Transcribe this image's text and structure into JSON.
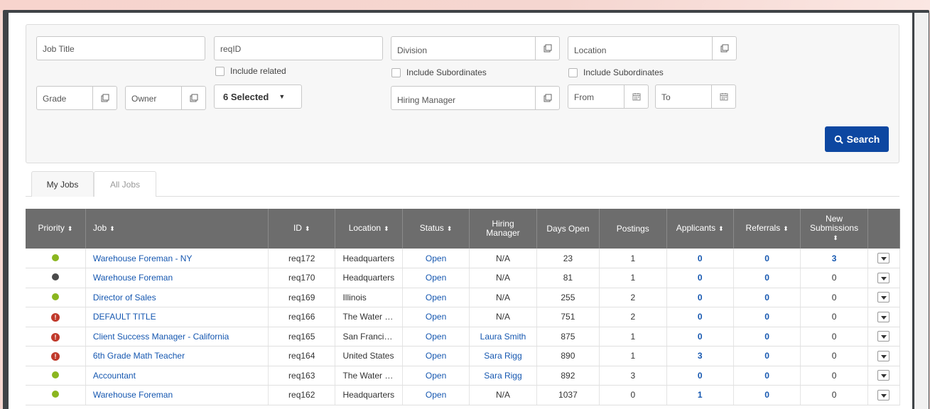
{
  "filters": {
    "job_title": "Job Title",
    "req_id": "reqID",
    "division": "Division",
    "location": "Location",
    "include_related": "Include related",
    "include_subordinates_division": "Include Subordinates",
    "include_subordinates_location": "Include Subordinates",
    "grade": "Grade",
    "owner": "Owner",
    "status_select": "6 Selected",
    "hiring_manager": "Hiring Manager",
    "from": "From",
    "to": "To",
    "search_label": "Search"
  },
  "tabs": [
    {
      "label": "My Jobs",
      "active": true
    },
    {
      "label": "All Jobs",
      "active": false
    }
  ],
  "table": {
    "headers": {
      "priority": "Priority",
      "job": "Job",
      "id": "ID",
      "location": "Location",
      "status": "Status",
      "hiring_manager": "Hiring Manager",
      "days_open": "Days Open",
      "postings": "Postings",
      "applicants": "Applicants",
      "referrals": "Referrals",
      "new_submissions": "New Submissions"
    },
    "sort_glyph": "⬍",
    "rows": [
      {
        "priority": "green",
        "job": "Warehouse Foreman - NY",
        "id": "req172",
        "location": "Headquarters",
        "status": "Open",
        "manager": "N/A",
        "days": "23",
        "postings": "1",
        "applicants": "0",
        "referrals": "0",
        "new": "3"
      },
      {
        "priority": "dark",
        "job": "Warehouse Foreman",
        "id": "req170",
        "location": "Headquarters",
        "status": "Open",
        "manager": "N/A",
        "days": "81",
        "postings": "1",
        "applicants": "0",
        "referrals": "0",
        "new": "0"
      },
      {
        "priority": "green",
        "job": "Director of Sales",
        "id": "req169",
        "location": "Illinois",
        "status": "Open",
        "manager": "N/A",
        "days": "255",
        "postings": "2",
        "applicants": "0",
        "referrals": "0",
        "new": "0"
      },
      {
        "priority": "warn",
        "job": "DEFAULT TITLE",
        "id": "req166",
        "location": "The Water …",
        "status": "Open",
        "manager": "N/A",
        "days": "751",
        "postings": "2",
        "applicants": "0",
        "referrals": "0",
        "new": "0"
      },
      {
        "priority": "warn",
        "job": "Client Success Manager - California",
        "id": "req165",
        "location": "San Franci…",
        "status": "Open",
        "manager": "Laura Smith",
        "days": "875",
        "postings": "1",
        "applicants": "0",
        "referrals": "0",
        "new": "0"
      },
      {
        "priority": "warn",
        "job": "6th Grade Math Teacher",
        "id": "req164",
        "location": "United States",
        "status": "Open",
        "manager": "Sara Rigg",
        "days": "890",
        "postings": "1",
        "applicants": "3",
        "referrals": "0",
        "new": "0"
      },
      {
        "priority": "green",
        "job": "Accountant",
        "id": "req163",
        "location": "The Water …",
        "status": "Open",
        "manager": "Sara Rigg",
        "days": "892",
        "postings": "3",
        "applicants": "0",
        "referrals": "0",
        "new": "0"
      },
      {
        "priority": "green",
        "job": "Warehouse Foreman",
        "id": "req162",
        "location": "Headquarters",
        "status": "Open",
        "manager": "N/A",
        "days": "1037",
        "postings": "0",
        "applicants": "1",
        "referrals": "0",
        "new": "0"
      }
    ]
  },
  "colors": {
    "green": "#8ab61f",
    "dark": "#4a4a4a",
    "warn": "#c0392b",
    "accent": "#0d47a1",
    "header": "#6d6d6d"
  }
}
